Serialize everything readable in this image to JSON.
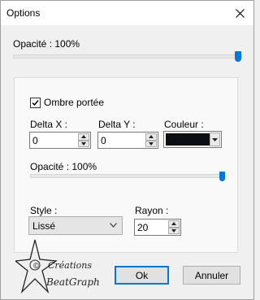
{
  "window": {
    "title": "Options"
  },
  "main_opacity": {
    "label": "Opacité : 100%",
    "value_percent": 100
  },
  "shadow": {
    "checkbox_label": "Ombre portée",
    "checked": true,
    "delta_x": {
      "label": "Delta X :",
      "value": "0"
    },
    "delta_y": {
      "label": "Delta Y :",
      "value": "0"
    },
    "color": {
      "label": "Couleur :",
      "value": "#0b0f14"
    },
    "opacity": {
      "label": "Opacité : 100%",
      "value_percent": 100
    },
    "style": {
      "label": "Style :",
      "selected": "Lissé"
    },
    "radius": {
      "label": "Rayon :",
      "value": "20"
    }
  },
  "buttons": {
    "ok": "Ok",
    "cancel": "Annuler"
  },
  "watermark": {
    "line1": "Créations",
    "line2": "BeatGraph",
    "mark": "©"
  },
  "colors": {
    "accent": "#0078d7",
    "window_bg": "#f0f0f0",
    "group_bg": "#f9f9f9"
  }
}
